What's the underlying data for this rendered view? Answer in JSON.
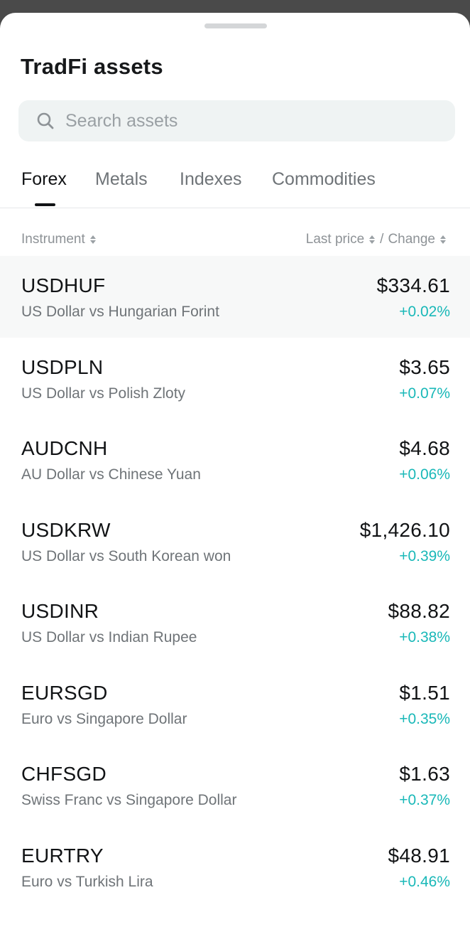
{
  "title": "TradFi assets",
  "search": {
    "placeholder": "Search assets",
    "value": ""
  },
  "tabs": [
    {
      "label": "Forex",
      "active": true
    },
    {
      "label": "Metals",
      "active": false
    },
    {
      "label": "Indexes",
      "active": false
    },
    {
      "label": "Commodities",
      "active": false
    }
  ],
  "columns": {
    "instrument": "Instrument",
    "last_price": "Last price",
    "separator": "/",
    "change": "Change"
  },
  "icons": {
    "search": "search-icon",
    "sort": "sort-icon"
  },
  "colors": {
    "positive_change": "#19b8b8",
    "text_primary": "#111315",
    "text_secondary": "#6f7478"
  },
  "assets": [
    {
      "symbol": "USDHUF",
      "name": "US Dollar vs Hungarian Forint",
      "price": "$334.61",
      "change": "+0.02%"
    },
    {
      "symbol": "USDPLN",
      "name": "US Dollar vs Polish Zloty",
      "price": "$3.65",
      "change": "+0.07%"
    },
    {
      "symbol": "AUDCNH",
      "name": "AU Dollar vs Chinese Yuan",
      "price": "$4.68",
      "change": "+0.06%"
    },
    {
      "symbol": "USDKRW",
      "name": "US Dollar vs South Korean won",
      "price": "$1,426.10",
      "change": "+0.39%"
    },
    {
      "symbol": "USDINR",
      "name": "US Dollar vs Indian Rupee",
      "price": "$88.82",
      "change": "+0.38%"
    },
    {
      "symbol": "EURSGD",
      "name": "Euro vs Singapore Dollar",
      "price": "$1.51",
      "change": "+0.35%"
    },
    {
      "symbol": "CHFSGD",
      "name": "Swiss Franc vs Singapore Dollar",
      "price": "$1.63",
      "change": "+0.37%"
    },
    {
      "symbol": "EURTRY",
      "name": "Euro vs Turkish Lira",
      "price": "$48.91",
      "change": "+0.46%"
    }
  ]
}
